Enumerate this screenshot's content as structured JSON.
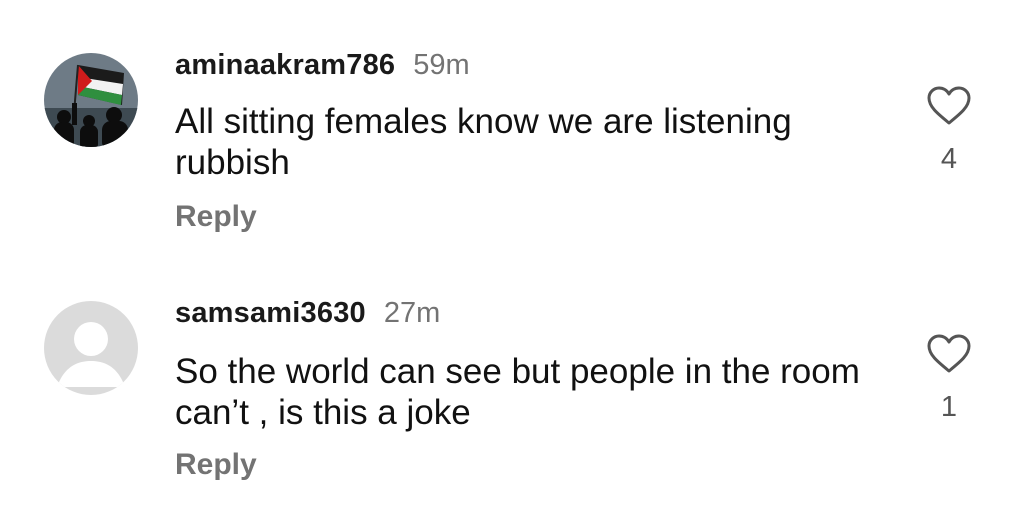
{
  "comments": [
    {
      "username": "aminaakram786",
      "time": "59m",
      "text": "All sitting females know we are listening rubbish",
      "reply_label": "Reply",
      "likes": "4",
      "avatar": "flag-photo"
    },
    {
      "username": "samsami3630",
      "time": "27m",
      "text": "So the world can see but people in the room can’t , is this a joke",
      "reply_label": "Reply",
      "likes": "1",
      "avatar": "default-person"
    }
  ],
  "icons": {
    "like": "heart-outline-icon"
  },
  "colors": {
    "secondary_text": "#737373",
    "placeholder_avatar": "#dbdbdb"
  }
}
